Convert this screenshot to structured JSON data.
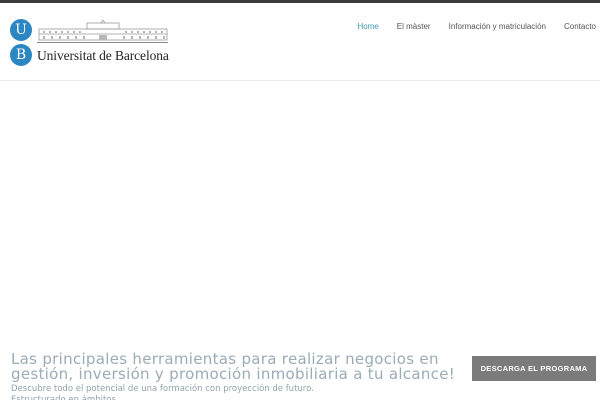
{
  "logo": {
    "letter_top": "U",
    "letter_bottom": "B",
    "name": "Universitat de Barcelona"
  },
  "nav": {
    "items": [
      "Home",
      "El màster",
      "Información y matriculación",
      "Contacto"
    ],
    "active": "Home"
  },
  "hero": {
    "headline": "Las principales herramientas para realizar negocios en gestión, inversión y promoción inmobiliaria a tu alcance!",
    "subline": "Descubre todo el potencial de una formación con proyección de futuro.",
    "subline_partial": "Estructurado en ámbitos"
  },
  "cta": {
    "label": "DESCARGA EL PROGRAMA"
  },
  "colors": {
    "brand_blue": "#2b86c1",
    "nav_active": "#3f98ae",
    "headline": "#9aacb7",
    "button": "#7b7b7b"
  }
}
